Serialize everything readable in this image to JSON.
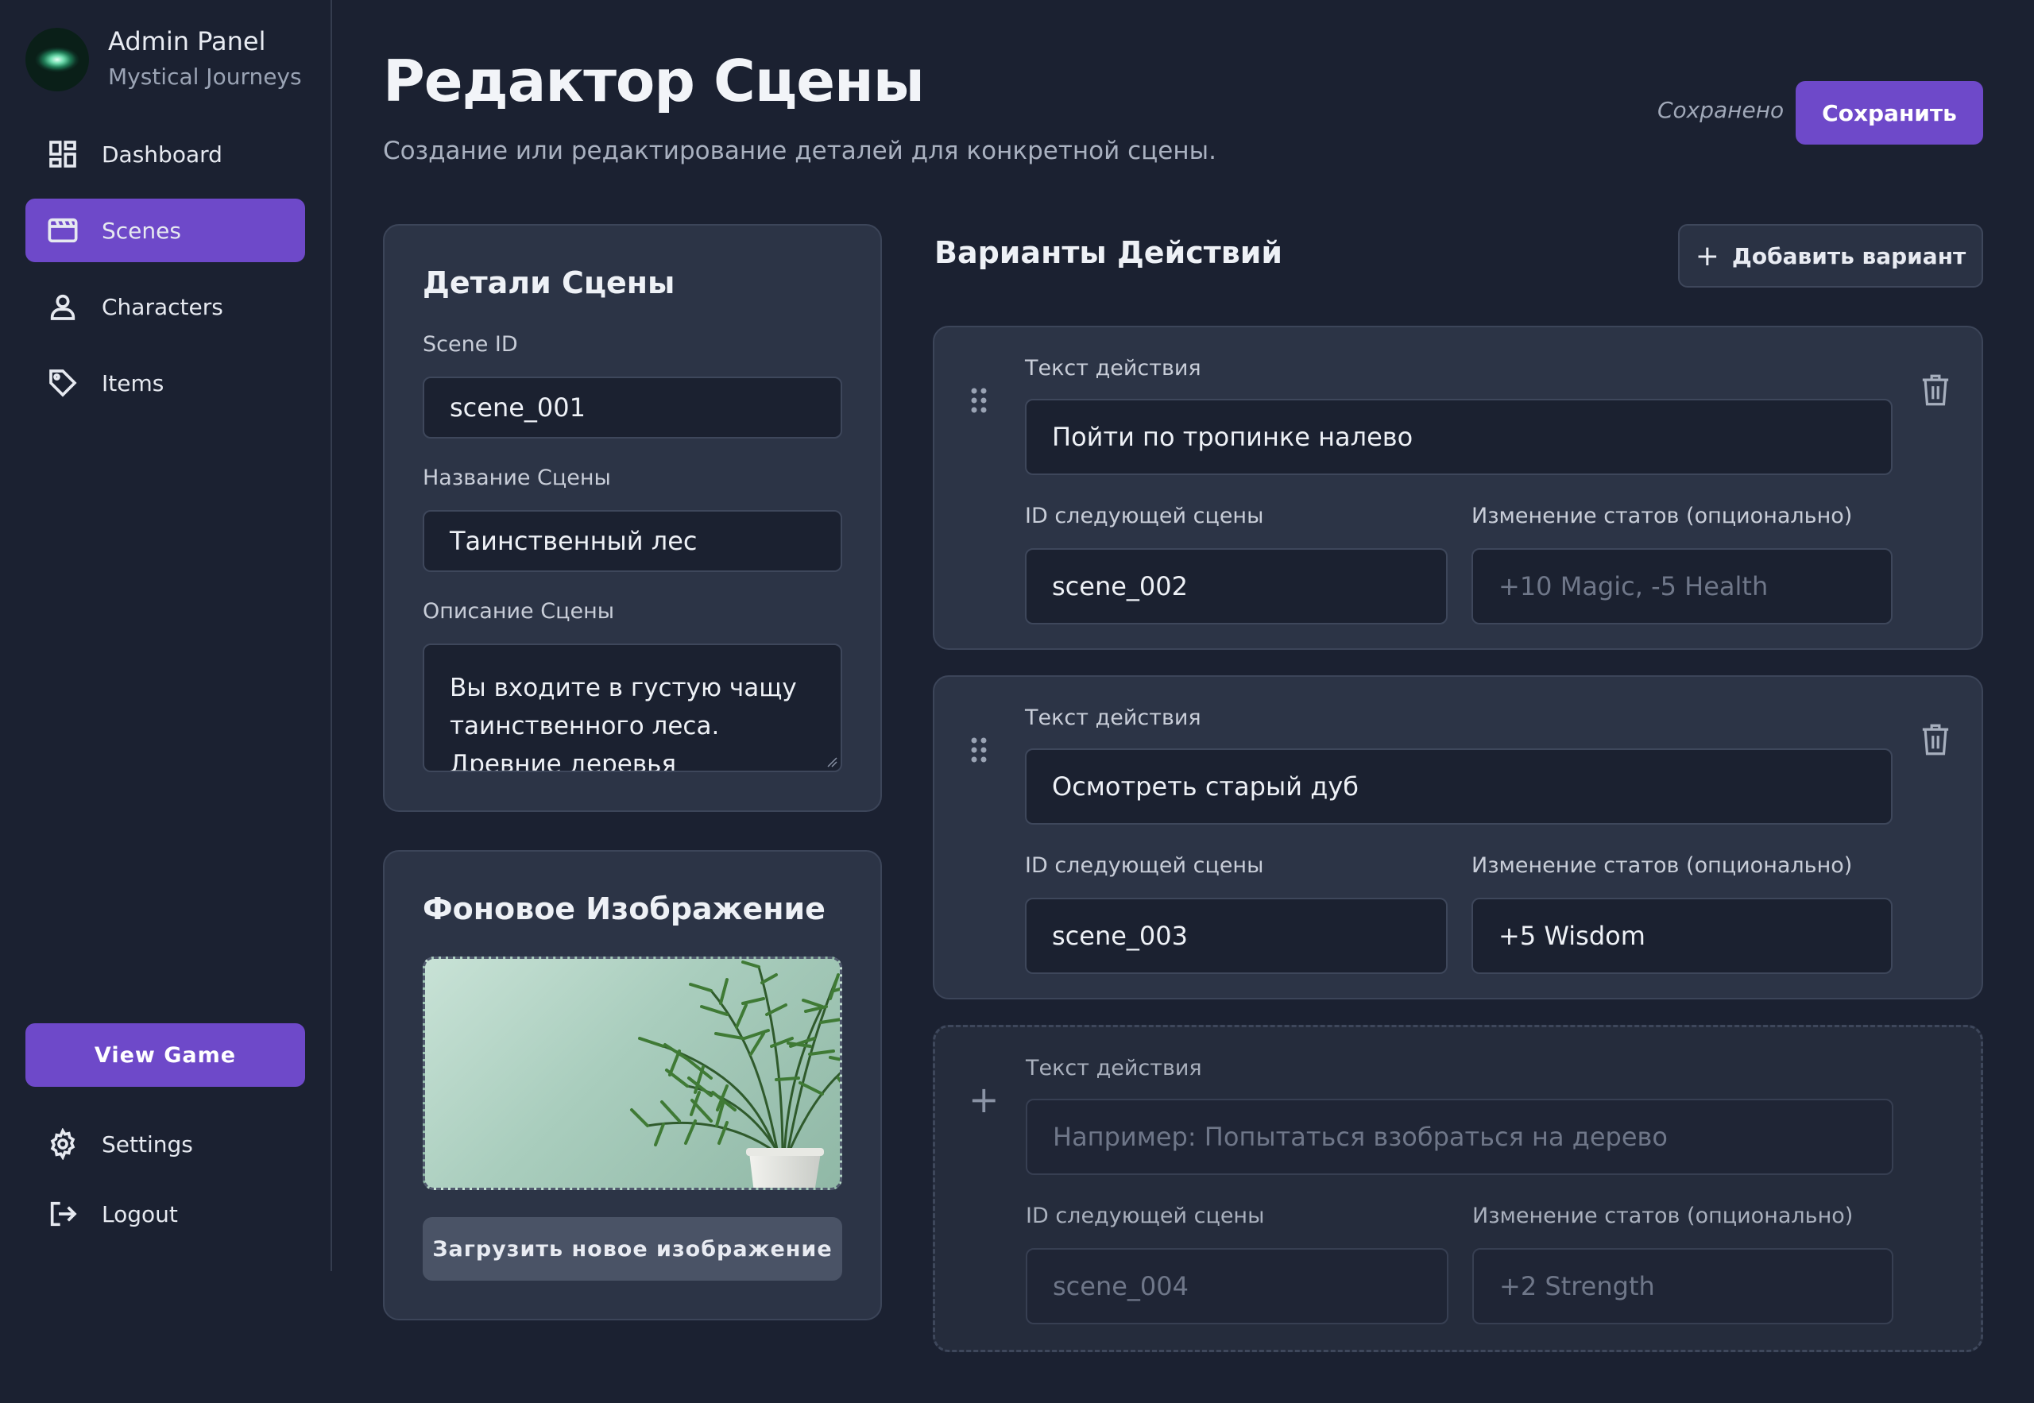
{
  "brand": {
    "title": "Admin Panel",
    "subtitle": "Mystical Journeys"
  },
  "sidebar": {
    "items": [
      {
        "label": "Dashboard",
        "icon": "dashboard-icon",
        "active": false
      },
      {
        "label": "Scenes",
        "icon": "clapperboard-icon",
        "active": true
      },
      {
        "label": "Characters",
        "icon": "user-icon",
        "active": false
      },
      {
        "label": "Items",
        "icon": "tag-icon",
        "active": false
      }
    ],
    "view_game": "View Game",
    "bottom": [
      {
        "label": "Settings",
        "icon": "gear-icon"
      },
      {
        "label": "Logout",
        "icon": "logout-icon"
      }
    ]
  },
  "header": {
    "title": "Редактор Сцены",
    "subtitle": "Создание или редактирование деталей для конкретной сцены.",
    "status": "Сохранено",
    "save_label": "Сохранить"
  },
  "details": {
    "title": "Детали Сцены",
    "scene_id_label": "Scene ID",
    "scene_id": "scene_001",
    "name_label": "Название Сцены",
    "name": "Таинственный лес",
    "desc_label": "Описание Сцены",
    "desc": "Вы входите в густую чащу таинственного леса. Древние деревья возвышаются над"
  },
  "background": {
    "title": "Фоновое Изображение",
    "upload_label": "Загрузить новое изображение"
  },
  "actions": {
    "title": "Варианты Действий",
    "add_label": "Добавить вариант",
    "text_label": "Текст действия",
    "next_label": "ID следующей сцены",
    "stats_label": "Изменение статов (опционально)",
    "items": [
      {
        "text": "Пойти по тропинке налево",
        "next": "scene_002",
        "stats": "",
        "stats_placeholder": "+10 Magic, -5 Health"
      },
      {
        "text": "Осмотреть старый дуб",
        "next": "scene_003",
        "stats": "+5 Wisdom",
        "stats_placeholder": ""
      }
    ],
    "new": {
      "text_placeholder": "Например: Попытаться взобраться на дерево",
      "next_placeholder": "scene_004",
      "stats_placeholder": "+2 Strength"
    }
  },
  "colors": {
    "accent": "#6e49c9",
    "bg": "#1b2131",
    "card": "#2c3446"
  }
}
